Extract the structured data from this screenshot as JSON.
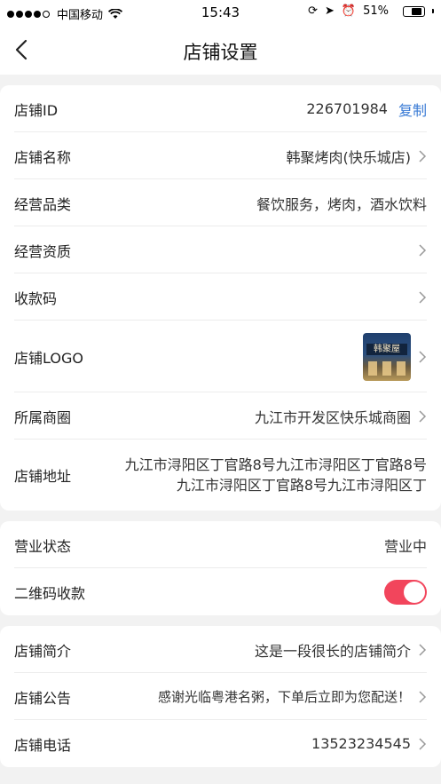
{
  "status_bar": {
    "carrier": "中国移动",
    "time": "15:43",
    "battery_percent": "51%",
    "battery_level": 0.51,
    "signal_bars": 4
  },
  "nav": {
    "title": "店铺设置",
    "back_icon": "chevron-left-icon"
  },
  "section1": {
    "shop_id": {
      "label": "店铺ID",
      "value": "226701984",
      "action": "复制"
    },
    "shop_name": {
      "label": "店铺名称",
      "value": "韩聚烤肉(快乐城店)"
    },
    "category": {
      "label": "经营品类",
      "value": "餐饮服务，烤肉，酒水饮料"
    },
    "qualification": {
      "label": "经营资质"
    },
    "payment_code": {
      "label": "收款码"
    },
    "logo": {
      "label": "店铺LOGO",
      "image_text": "韩聚屋"
    },
    "business_district": {
      "label": "所属商圈",
      "value": "九江市开发区快乐城商圈"
    },
    "address": {
      "label": "店铺地址",
      "value": "九江市浔阳区丁官路8号九江市浔阳区丁官路8号九江市浔阳区丁官路8号九江市浔阳区丁"
    }
  },
  "section2": {
    "business_status": {
      "label": "营业状态",
      "value": "营业中"
    },
    "qr_payment": {
      "label": "二维码收款",
      "enabled": true
    }
  },
  "section3": {
    "intro": {
      "label": "店铺简介",
      "value": "这是一段很长的店铺简介"
    },
    "notice": {
      "label": "店铺公告",
      "value": "感谢光临粤港名粥，下单后立即为您配送！"
    },
    "phone": {
      "label": "店铺电话",
      "value": "13523234545"
    }
  },
  "colors": {
    "accent_link": "#3a7bd5",
    "toggle_on": "#f2455c",
    "background": "#f2f2f2"
  }
}
